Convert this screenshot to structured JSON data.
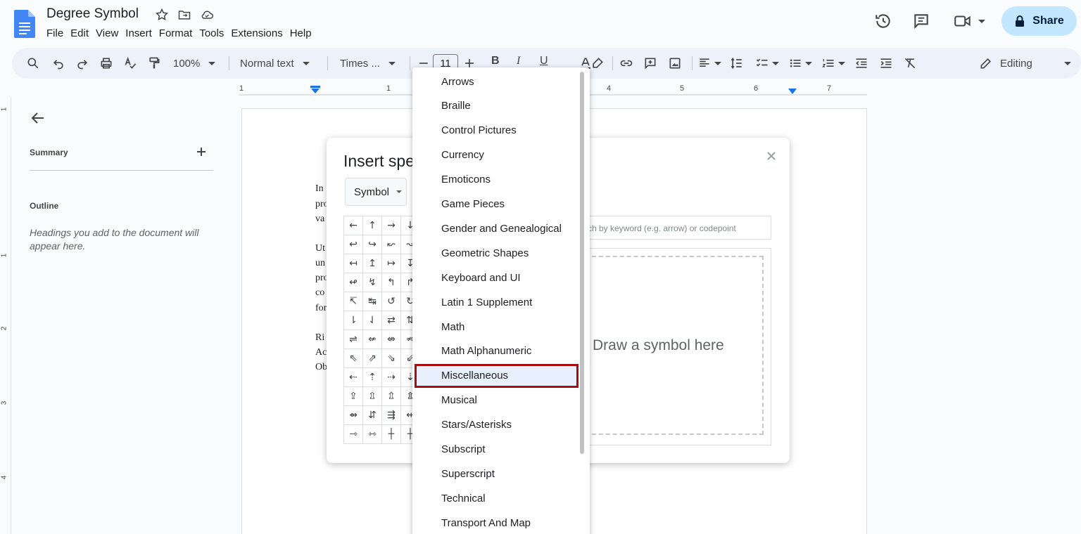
{
  "header": {
    "doc_title": "Degree Symbol",
    "menus": [
      "File",
      "Edit",
      "View",
      "Insert",
      "Format",
      "Tools",
      "Extensions",
      "Help"
    ],
    "share_label": "Share"
  },
  "toolbar": {
    "zoom": "100%",
    "style": "Normal text",
    "font": "Times ...",
    "font_size": "11",
    "mode": "Editing"
  },
  "ruler": {
    "numbers": [
      "1",
      "1",
      "4",
      "5",
      "6",
      "7"
    ],
    "vnumbers": [
      "1",
      "1",
      "2",
      "3",
      "4"
    ]
  },
  "sidebar": {
    "summary_label": "Summary",
    "outline_label": "Outline",
    "outline_hint": "Headings you add to the document will appear here."
  },
  "document": {
    "fragments": [
      "In",
      "pro",
      "va",
      "Ut",
      "un",
      "pro",
      "co",
      "for",
      "Ri",
      "Ac",
      "Ob"
    ]
  },
  "dialog": {
    "title": "Insert spe",
    "category_select": "Symbol",
    "search_placeholder": "rch by keyword (e.g. arrow) or codepoint",
    "draw_label": "Draw a symbol here",
    "grid": [
      [
        "←",
        "↑",
        "→",
        "↓"
      ],
      [
        "↩",
        "↪",
        "↜",
        "↝"
      ],
      [
        "↤",
        "↥",
        "↦",
        "↧"
      ],
      [
        "↫",
        "↯",
        "↰",
        "↱"
      ],
      [
        "↸",
        "↹",
        "↺",
        "↻"
      ],
      [
        "⇂",
        "⇃",
        "⇄",
        "⇅"
      ],
      [
        "⇌",
        "⇍",
        "⇎",
        "⇏"
      ],
      [
        "⇖",
        "⇗",
        "⇘",
        "⇙"
      ],
      [
        "⇠",
        "⇡",
        "⇢",
        "⇣"
      ],
      [
        "⇪",
        "⇫",
        "⇬",
        "⇭"
      ],
      [
        "⇴",
        "⇵",
        "⇶",
        "⇷"
      ],
      [
        "⇾",
        "⇿",
        "┼",
        "┼"
      ]
    ]
  },
  "dropdown": {
    "items": [
      "Arrows",
      "Braille",
      "Control Pictures",
      "Currency",
      "Emoticons",
      "Game Pieces",
      "Gender and Genealogical",
      "Geometric Shapes",
      "Keyboard and UI",
      "Latin 1 Supplement",
      "Math",
      "Math Alphanumeric",
      "Miscellaneous",
      "Musical",
      "Stars/Asterisks",
      "Subscript",
      "Superscript",
      "Technical",
      "Transport And Map"
    ],
    "selected": "Miscellaneous"
  },
  "colors": {
    "accent": "#c2e7ff",
    "highlight_border": "#a50e0e",
    "doc_icon": "#4285f4"
  }
}
